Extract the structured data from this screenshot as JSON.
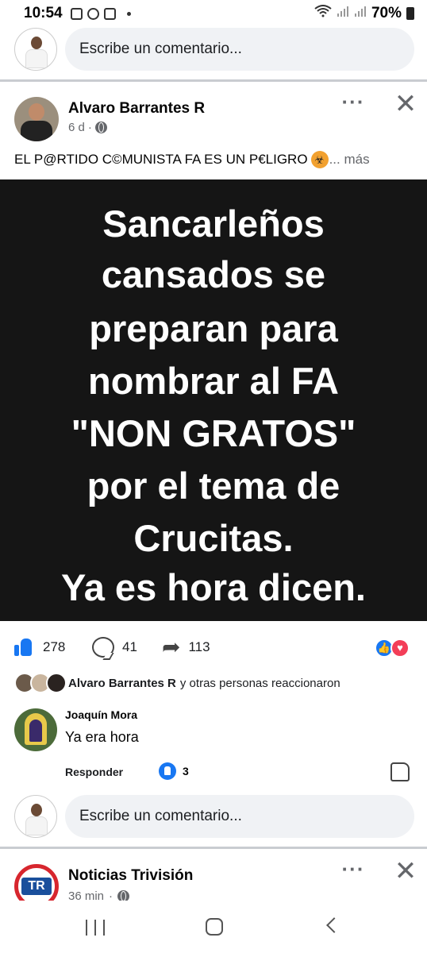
{
  "status_bar": {
    "time": "10:54",
    "battery": "70%",
    "icons": [
      "gallery-icon",
      "whatsapp-icon",
      "instagram-icon",
      "dot-icon",
      "wifi-icon",
      "signal-icon",
      "signal-icon",
      "battery-icon"
    ]
  },
  "top_composer": {
    "placeholder": "Escribe un comentario..."
  },
  "post": {
    "author": "Alvaro Barrantes R",
    "time": "6 d",
    "separator": "·",
    "text": "EL P@RTIDO C©MUNISTA FA ES UN P€LIGRO",
    "emoji": "☣",
    "more": "... más",
    "image_lines": [
      "Sancarleños",
      "cansados se",
      "preparan  para",
      "nombrar  al FA",
      "\"NON GRATOS\"",
      "por el tema  de",
      "Crucitas.",
      "Ya es hora dicen."
    ],
    "likes": "278",
    "comments": "41",
    "shares": "113",
    "reacted_name": "Alvaro Barrantes R",
    "reacted_suffix": "y otras personas reaccionaron"
  },
  "comment": {
    "author": "Joaquín Mora",
    "text": "Ya era  hora",
    "reply": "Responder",
    "likes": "3"
  },
  "bottom_composer": {
    "placeholder": "Escribe un comentario..."
  },
  "next_post": {
    "author": "Noticias Trivisión",
    "logo_text": "TR",
    "time": "36 min",
    "separator": "·"
  },
  "colors": {
    "accent": "#1877f2",
    "love": "#f33e58",
    "image_bg": "#151515",
    "input_bg": "#f0f2f5",
    "secondary_text": "#65676b"
  }
}
